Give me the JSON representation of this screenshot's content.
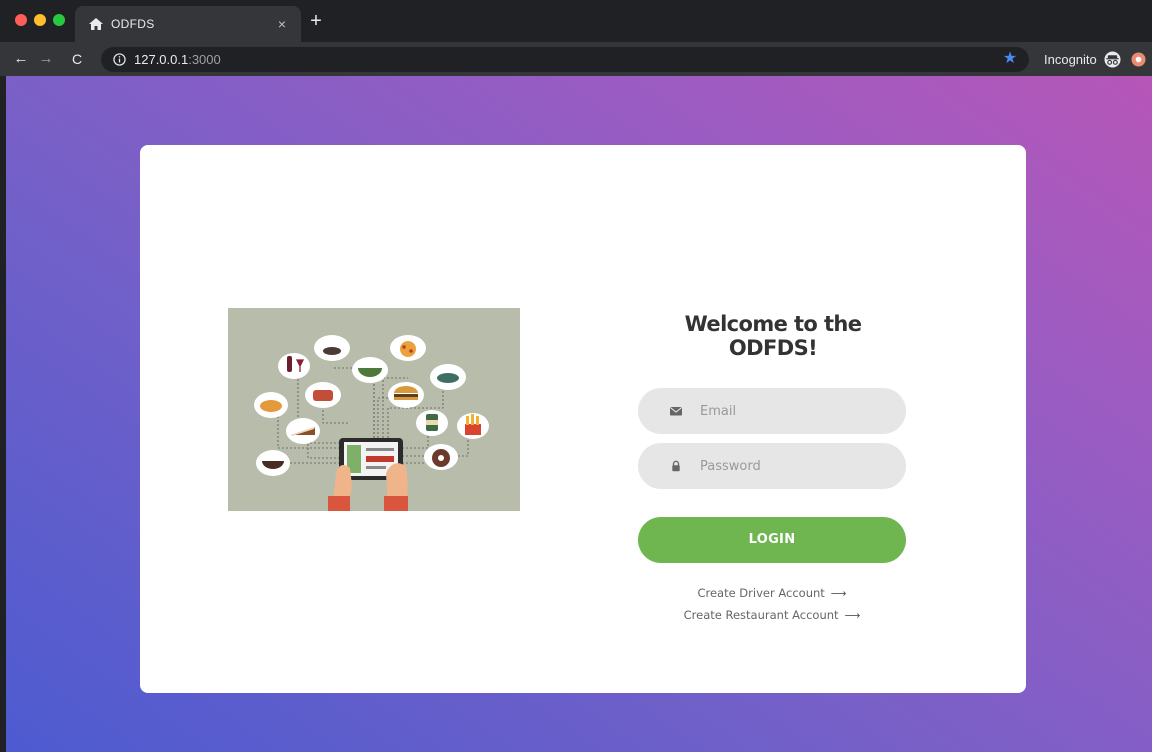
{
  "browser": {
    "tab_title": "ODFDS",
    "tab_close_glyph": "×",
    "new_tab_glyph": "+",
    "url_host": "127.0.0.1",
    "url_port": ":3000",
    "incognito_label": "Incognito",
    "icons": {
      "favicon": "home-icon",
      "info": "info-icon",
      "bookmark": "star-icon",
      "incognito": "incognito-icon",
      "extension": "extension-icon"
    }
  },
  "login": {
    "title": "Welcome to the ODFDS!",
    "email_placeholder": "Email",
    "password_placeholder": "Password",
    "login_label": "LOGIN",
    "driver_link": "Create Driver Account",
    "restaurant_link": "Create Restaurant Account",
    "arrow_glyph": "⟶"
  },
  "colors": {
    "accent_button": "#6fb550",
    "gradient_start": "#4d5bd0",
    "gradient_end": "#b656b8",
    "input_bg": "#e6e6e6"
  }
}
